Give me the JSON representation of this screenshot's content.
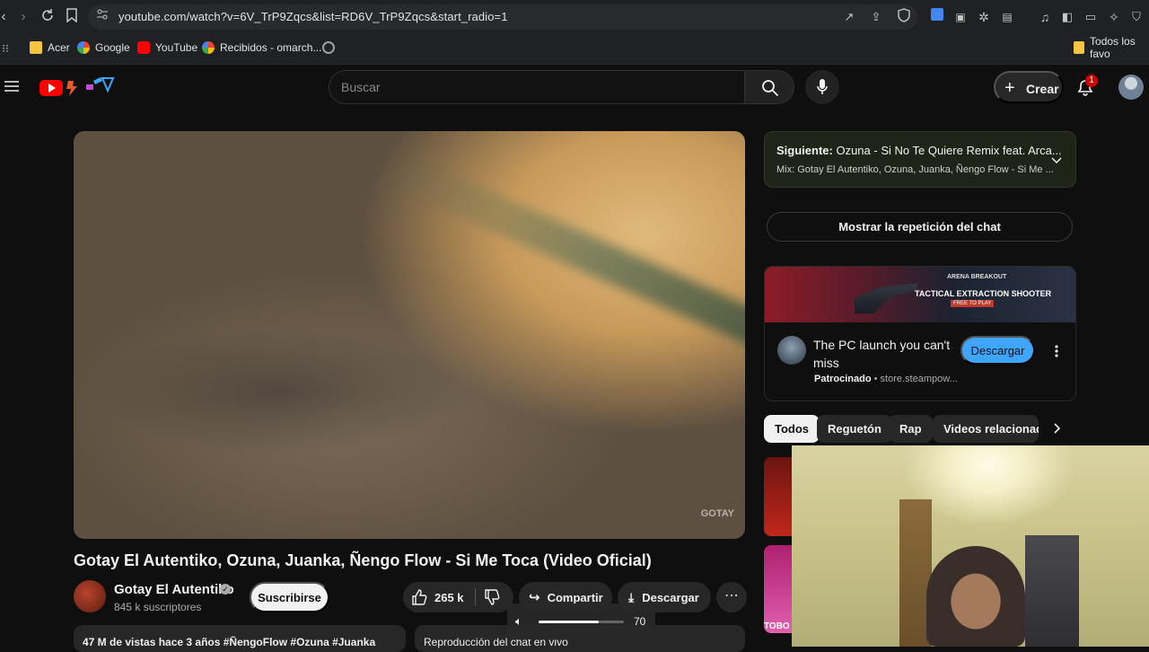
{
  "browser": {
    "url": "youtube.com/watch?v=6V_TrP9Zqcs&list=RD6V_TrP9Zqcs&start_radio=1",
    "bookmarks": [
      "Acer",
      "Google",
      "YouTube",
      "Recibidos - omarch..."
    ],
    "bookmarks_folder": "Todos los favo"
  },
  "header": {
    "search_placeholder": "Buscar",
    "create_label": "Crear",
    "notification_count": "1"
  },
  "video": {
    "watermark": "GOTAY",
    "title": "Gotay El Autentiko, Ozuna, Juanka, Ñengo Flow - Si Me Toca (Video Oficial)",
    "channel_name": "Gotay El Autentiko",
    "subscribers": "845 k suscriptores",
    "subscribe_label": "Suscribirse",
    "likes": "265 k",
    "share_label": "Compartir",
    "download_label": "Descargar",
    "description_preview": "47 M de vistas  hace 3 años  #ÑengoFlow #Ozuna #Juanka",
    "chat_replay_preview": "Reproducción del chat en vivo",
    "volume_value": "70",
    "volume_level": 0.7
  },
  "sidebar": {
    "next_prefix": "Siguiente:",
    "next_title": "Ozuna - Si No Te Quiere Remix feat. Arca...",
    "mix_subtitle": "Mix: Gotay El Autentiko, Ozuna, Juanka, Ñengo Flow - Si Me ...",
    "chat_replay_button": "Mostrar la repetición del chat",
    "ad": {
      "banner_brand": "ARENA BREAKOUT",
      "banner_tagline": "TACTICAL EXTRACTION SHOOTER",
      "banner_sub": "FREE TO PLAY",
      "title": "The PC launch you can't miss",
      "sponsored": "Patrocinado",
      "domain": "store.steampow...",
      "button": "Descargar"
    },
    "chips": [
      "Todos",
      "Reguetón",
      "Rap",
      "Videos relacionado"
    ],
    "thumb_label": "TOBO"
  },
  "colors": {
    "yt_red": "#ff0000",
    "accent_blue": "#3ea6ff",
    "background": "#0f0f0f"
  }
}
